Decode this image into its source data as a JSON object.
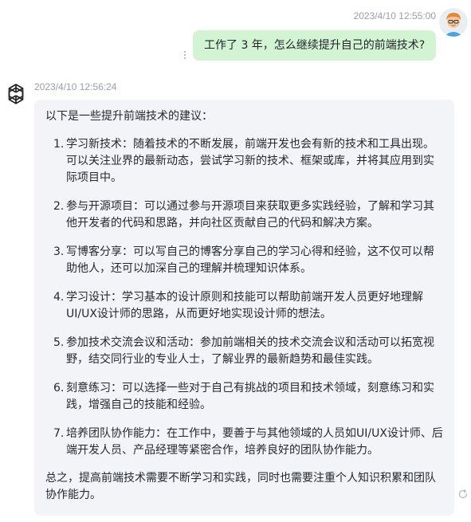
{
  "user_message": {
    "timestamp": "2023/4/10 12:55:00",
    "text": "工作了 3 年，怎么继续提升自己的前端技术?"
  },
  "assistant_message": {
    "timestamp": "2023/4/10 12:56:24",
    "intro": "以下是一些提升前端技术的建议：",
    "items": [
      {
        "num": "1.",
        "text": "学习新技术：随着技术的不断发展，前端开发也会有新的技术和工具出现。可以关注业界的最新动态，尝试学习新的技术、框架或库，并将其应用到实际项目中。"
      },
      {
        "num": "2.",
        "text": "参与开源项目：可以通过参与开源项目来获取更多实践经验，了解和学习其他开发者的代码和思路，并向社区贡献自己的代码和解决方案。"
      },
      {
        "num": "3.",
        "text": "写博客分享：可以写自己的博客分享自己的学习心得和经验，这不仅可以帮助他人，还可以加深自己的理解并梳理知识体系。"
      },
      {
        "num": "4.",
        "text": "学习设计：学习基本的设计原则和技能可以帮助前端开发人员更好地理解UI/UX设计师的思路，从而更好地实现设计师的想法。"
      },
      {
        "num": "5.",
        "text": "参加技术交流会议和活动：参加前端相关的技术交流会议和活动可以拓宽视野，结交同行业的专业人士，了解业界的最新趋势和最佳实践。"
      },
      {
        "num": "6.",
        "text": "刻意练习：可以选择一些对于自己有挑战的项目和技术领域，刻意练习和实践，增强自己的技能和经验。"
      },
      {
        "num": "7.",
        "text": "培养团队协作能力：在工作中，要善于与其他领域的人员如UI/UX设计师、后端开发人员、产品经理等紧密合作，培养良好的团队协作能力。"
      }
    ],
    "conclusion": "总之，提高前端技术需要不断学习和实践，同时也需要注重个人知识积累和团队协作能力。"
  },
  "icons": {
    "user_avatar": "user-avatar-icon",
    "assistant_avatar": "openai-logo-icon",
    "more": "more-vertical-icon",
    "refresh": "refresh-icon"
  },
  "colors": {
    "user_bubble": "#d2f4d3",
    "assistant_bubble": "#f2f4f7",
    "timestamp": "#9aa0a6"
  }
}
